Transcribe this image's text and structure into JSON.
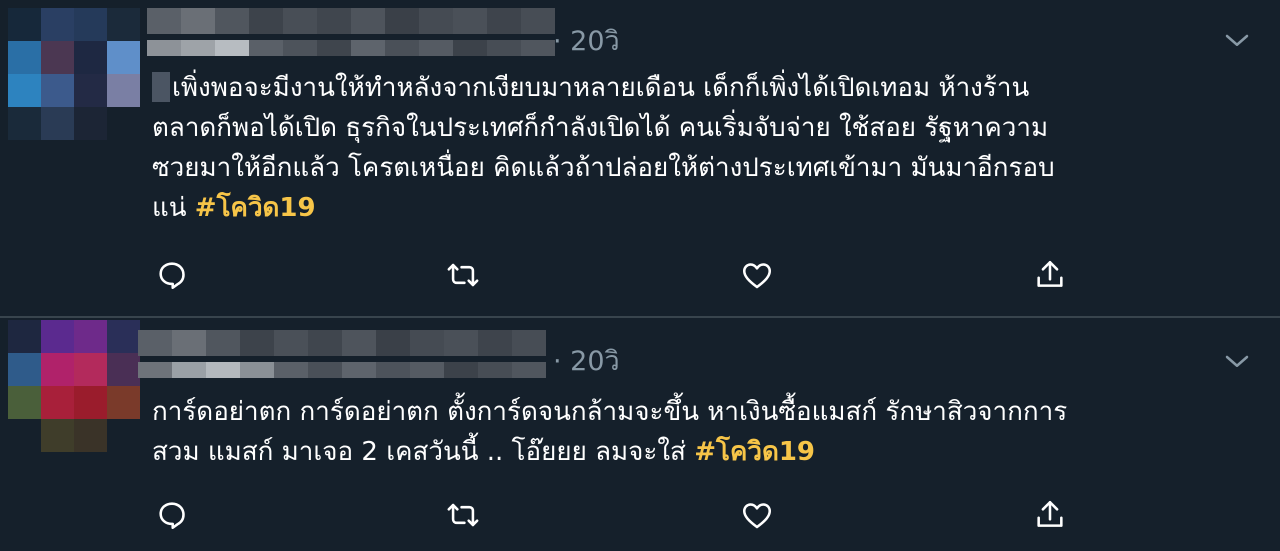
{
  "tweets": [
    {
      "time": "· 20วิ",
      "lines": [
        "เพิ่งพอจะมีงานให้ทำหลังจากเงียบมาหลายเดือน เด็กก็เพิ่งได้เปิดเทอม ห้างร้าน",
        "ตลาดก็พอได้เปิด ธุรกิจในประเทศก็กำลังเปิดได้ คนเริ่มจับจ่าย ใช้สอย รัฐหาความ",
        "ซวยมาให้อีกแล้ว โครตเหนื่อย คิดแล้วถ้าปล่อยให้ต่างประเทศเข้ามา มันมาอีกรอบ",
        "แน่"
      ],
      "hashtag": "#โควิด19"
    },
    {
      "time": "· 20วิ",
      "lines": [
        "การ์ดอย่าตก การ์ดอย่าตก ตั้งการ์ดจนกล้ามจะขึ้น หาเงินซื้อแมสก์ รักษาสิวจากการ",
        "สวม แมสก์ มาเจอ 2 เคสวันนี้ .. โอ๊ยยย ลมจะใส่"
      ],
      "hashtag": "#โควิด19"
    }
  ],
  "icons": [
    "reply-icon",
    "retweet-icon",
    "like-icon",
    "share-icon",
    "chevron-down-icon"
  ],
  "colors": {
    "background": "#15202b",
    "text": "#ffffff",
    "muted": "#8899a6",
    "hashtag": "#f7c548",
    "divider": "#38444d"
  }
}
